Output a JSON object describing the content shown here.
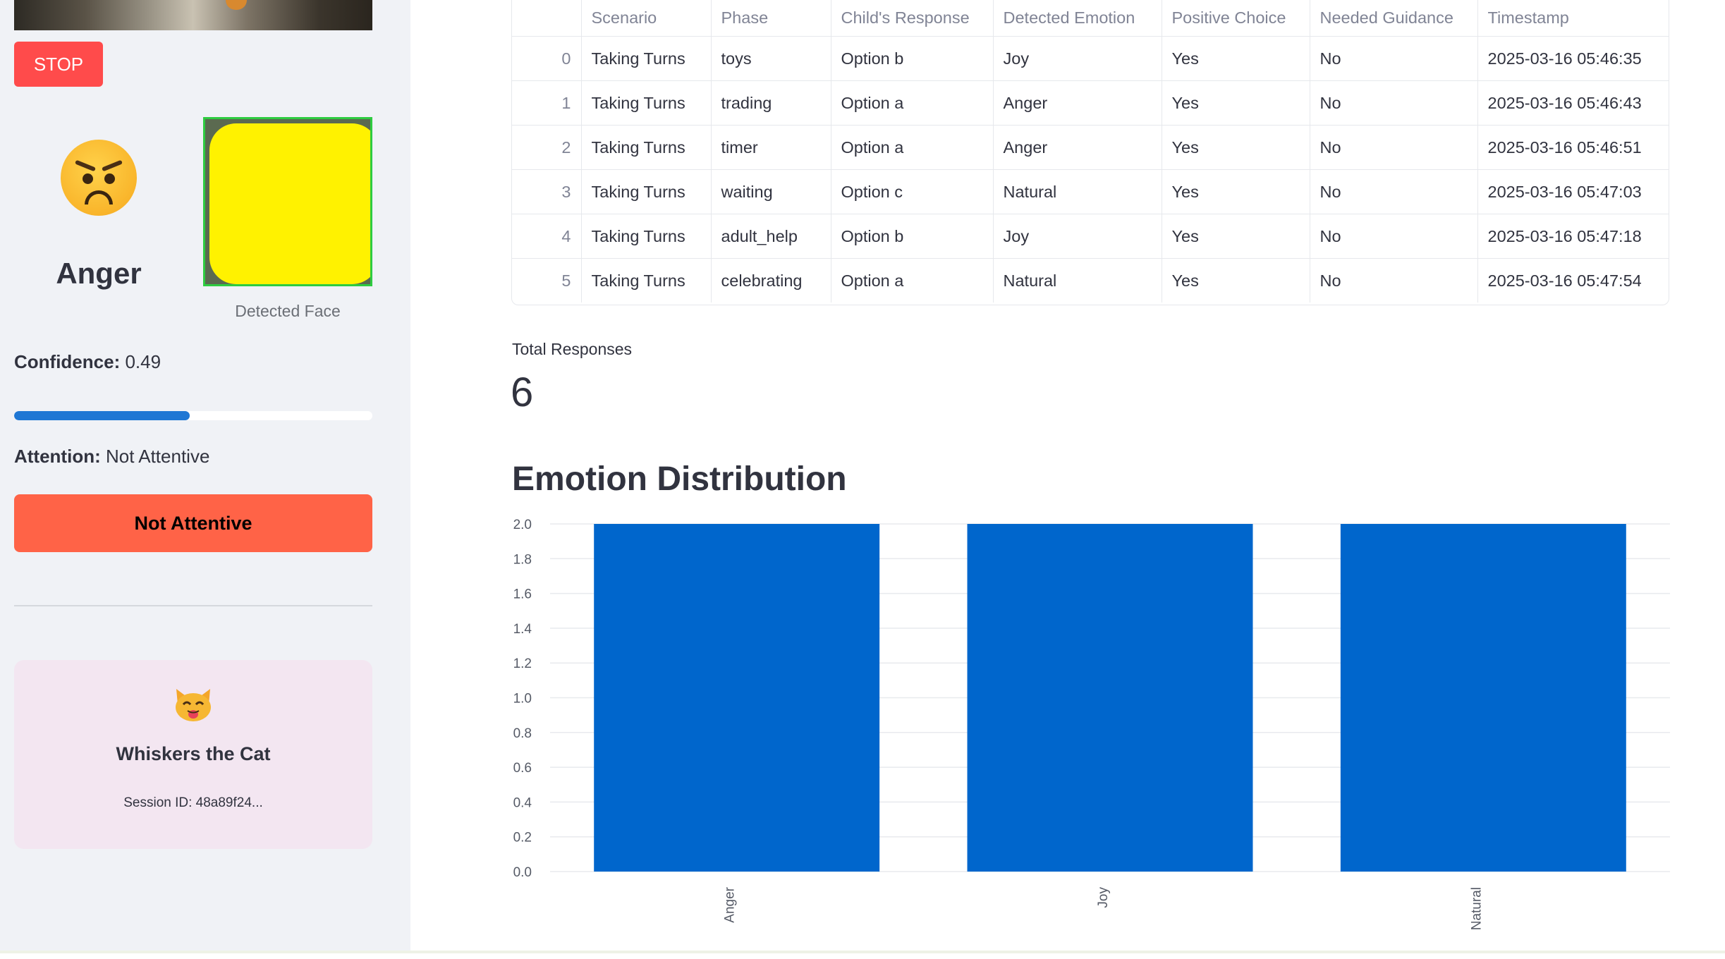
{
  "sidebar": {
    "stop_button": "STOP",
    "emotion": "Anger",
    "face_caption": "Detected Face",
    "confidence_label": "Confidence:",
    "confidence_value": "0.49",
    "confidence_fraction": 0.49,
    "attention_label": "Attention:",
    "attention_value": "Not Attentive",
    "attention_button": "Not Attentive",
    "buddy": {
      "name": "Whiskers the Cat",
      "session_id": "Session ID: 48a89f24..."
    }
  },
  "table": {
    "columns": [
      "",
      "Scenario",
      "Phase",
      "Child's Response",
      "Detected Emotion",
      "Positive Choice",
      "Needed Guidance",
      "Timestamp"
    ],
    "rows": [
      [
        "0",
        "Taking Turns",
        "toys",
        "Option b",
        "Joy",
        "Yes",
        "No",
        "2025-03-16 05:46:35"
      ],
      [
        "1",
        "Taking Turns",
        "trading",
        "Option a",
        "Anger",
        "Yes",
        "No",
        "2025-03-16 05:46:43"
      ],
      [
        "2",
        "Taking Turns",
        "timer",
        "Option a",
        "Anger",
        "Yes",
        "No",
        "2025-03-16 05:46:51"
      ],
      [
        "3",
        "Taking Turns",
        "waiting",
        "Option c",
        "Natural",
        "Yes",
        "No",
        "2025-03-16 05:47:03"
      ],
      [
        "4",
        "Taking Turns",
        "adult_help",
        "Option b",
        "Joy",
        "Yes",
        "No",
        "2025-03-16 05:47:18"
      ],
      [
        "5",
        "Taking Turns",
        "celebrating",
        "Option a",
        "Natural",
        "Yes",
        "No",
        "2025-03-16 05:47:54"
      ]
    ]
  },
  "metric": {
    "label": "Total Responses",
    "value": "6"
  },
  "chart_heading": "Emotion Distribution",
  "chart_data": {
    "type": "bar",
    "categories": [
      "Anger",
      "Joy",
      "Natural"
    ],
    "values": [
      2,
      2,
      2
    ],
    "ylim": [
      0,
      2
    ],
    "yticks": [
      "0.0",
      "0.2",
      "0.4",
      "0.6",
      "0.8",
      "1.0",
      "1.2",
      "1.4",
      "1.6",
      "1.8",
      "2.0"
    ],
    "bar_color": "#0066cc",
    "grid": true
  },
  "colors": {
    "stop": "#ff4b4b",
    "attention": "#ff6347",
    "progress": "#1f77d4",
    "buddy_card": "#f3e6f1"
  },
  "icons": {
    "emotion": "angry-face-icon",
    "buddy": "cat-face-icon"
  }
}
